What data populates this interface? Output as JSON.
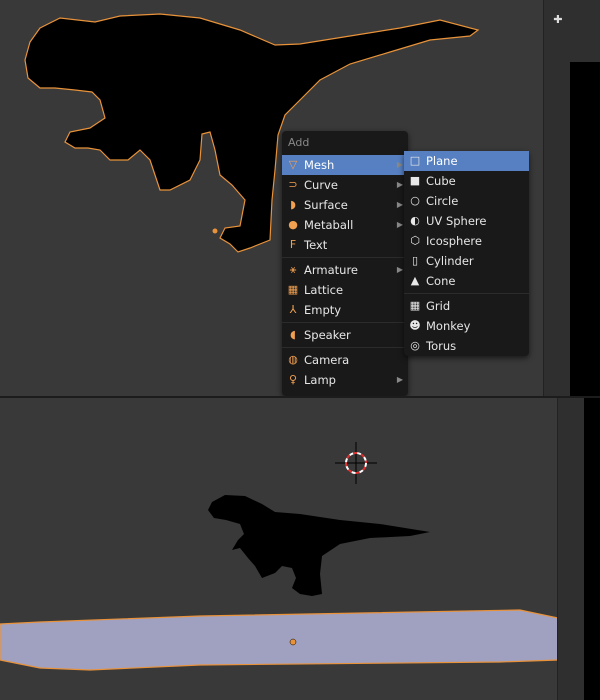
{
  "menus": {
    "add": {
      "title": "Add",
      "items": [
        {
          "label": "Mesh",
          "icon": "mesh-icon",
          "submenu": true,
          "active": true
        },
        {
          "label": "Curve",
          "icon": "curve-icon",
          "submenu": true
        },
        {
          "label": "Surface",
          "icon": "surface-icon",
          "submenu": true
        },
        {
          "label": "Metaball",
          "icon": "metaball-icon",
          "submenu": true
        },
        {
          "label": "Text",
          "icon": "text-icon",
          "submenu": false
        },
        {
          "label": "Armature",
          "icon": "armature-icon",
          "submenu": true
        },
        {
          "label": "Lattice",
          "icon": "lattice-icon",
          "submenu": false
        },
        {
          "label": "Empty",
          "icon": "empty-icon",
          "submenu": false
        },
        {
          "label": "Speaker",
          "icon": "speaker-icon",
          "submenu": false
        },
        {
          "label": "Camera",
          "icon": "camera-icon",
          "submenu": false
        },
        {
          "label": "Lamp",
          "icon": "lamp-icon",
          "submenu": true
        }
      ]
    },
    "mesh": {
      "items": [
        {
          "label": "Plane",
          "icon": "plane-icon",
          "active": true
        },
        {
          "label": "Cube",
          "icon": "cube-icon"
        },
        {
          "label": "Circle",
          "icon": "circle-icon"
        },
        {
          "label": "UV Sphere",
          "icon": "uv-sphere-icon"
        },
        {
          "label": "Icosphere",
          "icon": "icosphere-icon"
        },
        {
          "label": "Cylinder",
          "icon": "cylinder-icon"
        },
        {
          "label": "Cone",
          "icon": "cone-icon"
        },
        {
          "label": "Grid",
          "icon": "grid-icon"
        },
        {
          "label": "Monkey",
          "icon": "monkey-icon"
        },
        {
          "label": "Torus",
          "icon": "torus-icon"
        }
      ]
    }
  },
  "colors": {
    "viewport_bg": "#393939",
    "selection_outline": "#f0a030",
    "menu_bg": "#191919",
    "highlight": "#5680c2",
    "plane_fill": "#a0a0c0"
  }
}
